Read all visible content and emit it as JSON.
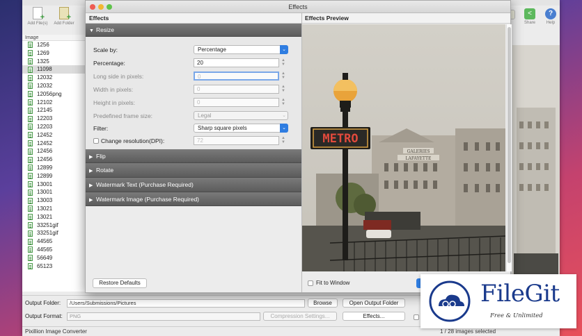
{
  "main_window": {
    "title": "Pixillion Image Converter",
    "toolbar": {
      "add_files": "Add File(s)",
      "add_folder": "Add Folder",
      "share": "Share",
      "help": "Help"
    },
    "list_header": "Image",
    "files": [
      "1256",
      "1269",
      "1325",
      "11098",
      "12032",
      "12032",
      "12056png",
      "12102",
      "12145",
      "12203",
      "12203",
      "12452",
      "12452",
      "12456",
      "12456",
      "12899",
      "12899",
      "13001",
      "13001",
      "13003",
      "13021",
      "13021",
      "33251gif",
      "33251gif",
      "44565",
      "44565",
      "56649",
      "65123"
    ],
    "selected_index": 3,
    "output_folder_label": "Output Folder:",
    "output_folder_value": "/Users/Submissions/Pictures",
    "browse_label": "Browse",
    "open_output_label": "Open Output Folder",
    "output_format_label": "Output Format:",
    "output_format_value": "PNG",
    "compression_label": "Compression Settings...",
    "effects_label": "Effects...",
    "status_left": "Pixillion Image Converter",
    "status_right": "1 / 28 images selected"
  },
  "effects": {
    "window_title": "Effects",
    "left_header": "Effects",
    "preview_header": "Effects Preview",
    "sections": {
      "resize": "Resize",
      "flip": "Flip",
      "rotate": "Rotate",
      "watermark_text": "Watermark Text (Purchase Required)",
      "watermark_image": "Watermark Image (Purchase Required)"
    },
    "resize": {
      "scale_by_label": "Scale by:",
      "scale_by_value": "Percentage",
      "percentage_label": "Percentage:",
      "percentage_value": "20",
      "long_side_label": "Long side in pixels:",
      "long_side_value": "0",
      "width_label": "Width in pixels:",
      "width_value": "0",
      "height_label": "Height in pixels:",
      "height_value": "0",
      "frame_label": "Predefined frame size:",
      "frame_value": "Legal",
      "filter_label": "Filter:",
      "filter_value": "Sharp square pixels",
      "dpi_label": "Change resolution(DPI):",
      "dpi_value": "72"
    },
    "restore_label": "Restore Defaults",
    "fit_label": "Fit to Window",
    "sign_text": "METRO",
    "building_text_1": "GALERIES",
    "building_text_2": "LAFAYETTE"
  },
  "watermark": {
    "name": "FileGit",
    "tagline": "Free & Unlimited"
  },
  "colors": {
    "accent": "#2f7de1",
    "section_header": "#6b6b6b",
    "watermark_blue": "#1a3a8c"
  }
}
